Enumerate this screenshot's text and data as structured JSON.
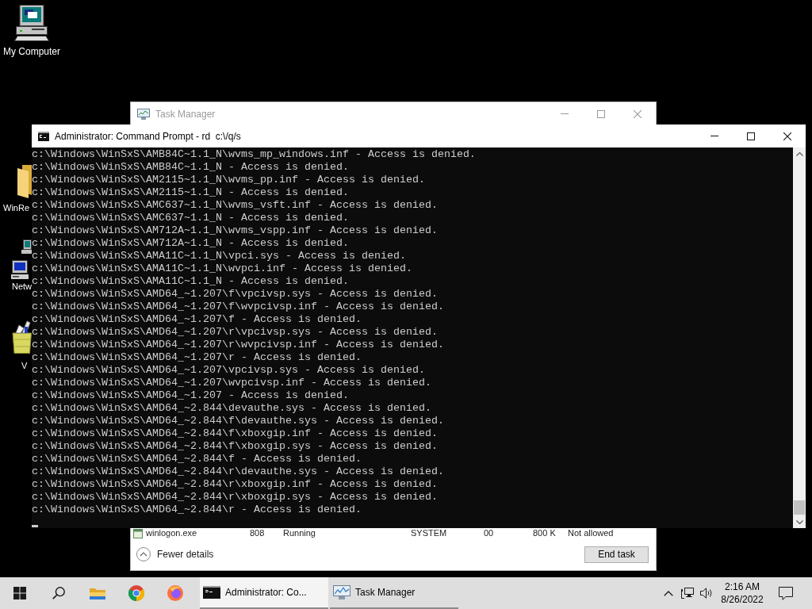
{
  "desktop": {
    "icons": [
      {
        "label": "My Computer"
      },
      {
        "label": "WinRe"
      },
      {
        "label": "Netw"
      },
      {
        "label": "V"
      }
    ]
  },
  "task_manager": {
    "title": "Task Manager",
    "active": false,
    "process_row": [
      "winlogon.exe",
      "808",
      "Running",
      "SYSTEM",
      "00",
      "800 K",
      "Not allowed"
    ],
    "details_toggle": "Fewer details",
    "end_task_button": "End task"
  },
  "command_prompt": {
    "title": "Administrator: Command Prompt - rd  c:\\/q/s",
    "active": true,
    "lines": [
      "c:\\Windows\\WinSxS\\AMB84C~1.1_N\\wvms_mp_windows.inf - Access is denied.",
      "c:\\Windows\\WinSxS\\AMB84C~1.1_N - Access is denied.",
      "c:\\Windows\\WinSxS\\AM2115~1.1_N\\wvms_pp.inf - Access is denied.",
      "c:\\Windows\\WinSxS\\AM2115~1.1_N - Access is denied.",
      "c:\\Windows\\WinSxS\\AMC637~1.1_N\\wvms_vsft.inf - Access is denied.",
      "c:\\Windows\\WinSxS\\AMC637~1.1_N - Access is denied.",
      "c:\\Windows\\WinSxS\\AM712A~1.1_N\\wvms_vspp.inf - Access is denied.",
      "c:\\Windows\\WinSxS\\AM712A~1.1_N - Access is denied.",
      "c:\\Windows\\WinSxS\\AMA11C~1.1_N\\vpci.sys - Access is denied.",
      "c:\\Windows\\WinSxS\\AMA11C~1.1_N\\wvpci.inf - Access is denied.",
      "c:\\Windows\\WinSxS\\AMA11C~1.1_N - Access is denied.",
      "c:\\Windows\\WinSxS\\AMD64_~1.207\\f\\vpcivsp.sys - Access is denied.",
      "c:\\Windows\\WinSxS\\AMD64_~1.207\\f\\wvpcivsp.inf - Access is denied.",
      "c:\\Windows\\WinSxS\\AMD64_~1.207\\f - Access is denied.",
      "c:\\Windows\\WinSxS\\AMD64_~1.207\\r\\vpcivsp.sys - Access is denied.",
      "c:\\Windows\\WinSxS\\AMD64_~1.207\\r\\wvpcivsp.inf - Access is denied.",
      "c:\\Windows\\WinSxS\\AMD64_~1.207\\r - Access is denied.",
      "c:\\Windows\\WinSxS\\AMD64_~1.207\\vpcivsp.sys - Access is denied.",
      "c:\\Windows\\WinSxS\\AMD64_~1.207\\wvpcivsp.inf - Access is denied.",
      "c:\\Windows\\WinSxS\\AMD64_~1.207 - Access is denied.",
      "c:\\Windows\\WinSxS\\AMD64_~2.844\\devauthe.sys - Access is denied.",
      "c:\\Windows\\WinSxS\\AMD64_~2.844\\f\\devauthe.sys - Access is denied.",
      "c:\\Windows\\WinSxS\\AMD64_~2.844\\f\\xboxgip.inf - Access is denied.",
      "c:\\Windows\\WinSxS\\AMD64_~2.844\\f\\xboxgip.sys - Access is denied.",
      "c:\\Windows\\WinSxS\\AMD64_~2.844\\f - Access is denied.",
      "c:\\Windows\\WinSxS\\AMD64_~2.844\\r\\devauthe.sys - Access is denied.",
      "c:\\Windows\\WinSxS\\AMD64_~2.844\\r\\xboxgip.inf - Access is denied.",
      "c:\\Windows\\WinSxS\\AMD64_~2.844\\r\\xboxgip.sys - Access is denied.",
      "c:\\Windows\\WinSxS\\AMD64_~2.844\\r - Access is denied."
    ]
  },
  "taskbar": {
    "buttons": [
      {
        "label": "Administrator: Co...",
        "selected": true
      },
      {
        "label": "Task Manager",
        "selected": false
      }
    ],
    "clock": {
      "time": "2:16 AM",
      "date": "8/26/2022"
    }
  }
}
